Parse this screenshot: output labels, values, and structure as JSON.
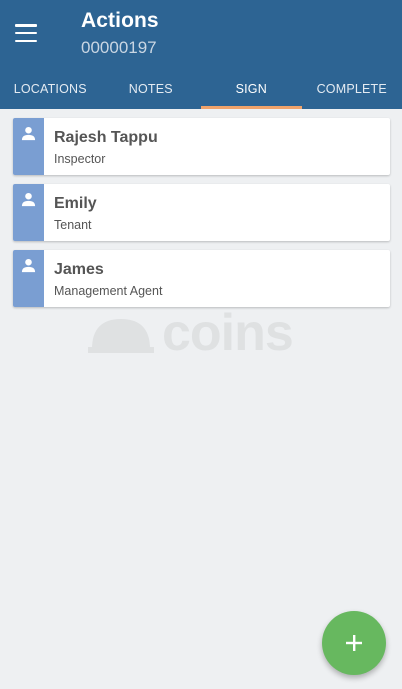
{
  "header": {
    "title": "Actions",
    "subtitle": "00000197"
  },
  "tabs": [
    {
      "label": "LOCATIONS",
      "active": false
    },
    {
      "label": "NOTES",
      "active": false
    },
    {
      "label": "SIGN",
      "active": true
    },
    {
      "label": "COMPLETE",
      "active": false
    }
  ],
  "signatories": [
    {
      "name": "Rajesh Tappu",
      "role": "Inspector"
    },
    {
      "name": "Emily",
      "role": "Tenant"
    },
    {
      "name": "James",
      "role": "Management Agent"
    }
  ],
  "watermark": {
    "text": "coins"
  },
  "icons": {
    "menu": "hamburger-menu-icon",
    "person": "person-icon",
    "add": "plus-icon"
  },
  "colors": {
    "header": "#2d6493",
    "tab_indicator": "#f0a36b",
    "card_strip": "#7a9ed2",
    "fab": "#67b85f"
  }
}
